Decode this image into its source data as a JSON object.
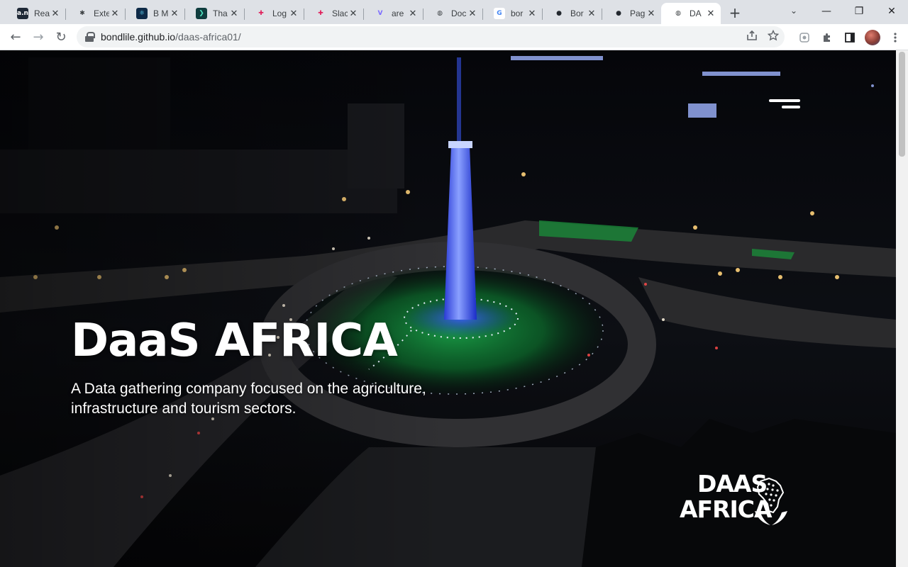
{
  "browser": {
    "tabs": [
      {
        "title": "Rea",
        "icon": "readme-icon",
        "active": false
      },
      {
        "title": "Exte",
        "icon": "puzzle-icon",
        "active": false
      },
      {
        "title": "B M",
        "icon": "react-icon",
        "active": false
      },
      {
        "title": "Tha",
        "icon": "arrow-app-icon",
        "active": false
      },
      {
        "title": "Log",
        "icon": "slack-icon",
        "active": false
      },
      {
        "title": "Slac",
        "icon": "slack-icon",
        "active": false
      },
      {
        "title": "are",
        "icon": "vmark-icon",
        "active": false
      },
      {
        "title": "Doc",
        "icon": "globe-icon",
        "active": false
      },
      {
        "title": "bor",
        "icon": "google-icon",
        "active": false
      },
      {
        "title": "Bor",
        "icon": "github-icon",
        "active": false
      },
      {
        "title": "Pag",
        "icon": "github-icon",
        "active": false
      },
      {
        "title": "DA",
        "icon": "globe-icon",
        "active": true
      }
    ],
    "new_tab": "+",
    "window": {
      "minimize": "—",
      "maximize": "❐",
      "close": "✕",
      "tab_search": "⌄"
    },
    "toolbar": {
      "back": "←",
      "forward": "→",
      "reload": "↻"
    },
    "url_host": "bondlile.github.io",
    "url_path": "/daas-africa01/"
  },
  "hero": {
    "title": "DaaS AFRICA",
    "subtitle": "A Data gathering company focused on the agriculture, infrastructure and tourism sectors."
  },
  "logo": {
    "line1": "DAAS",
    "line2": "AFRICA"
  },
  "colors": {
    "accent_blue": "#2a3cff",
    "accent_green": "#22c55e",
    "text": "#ffffff"
  }
}
